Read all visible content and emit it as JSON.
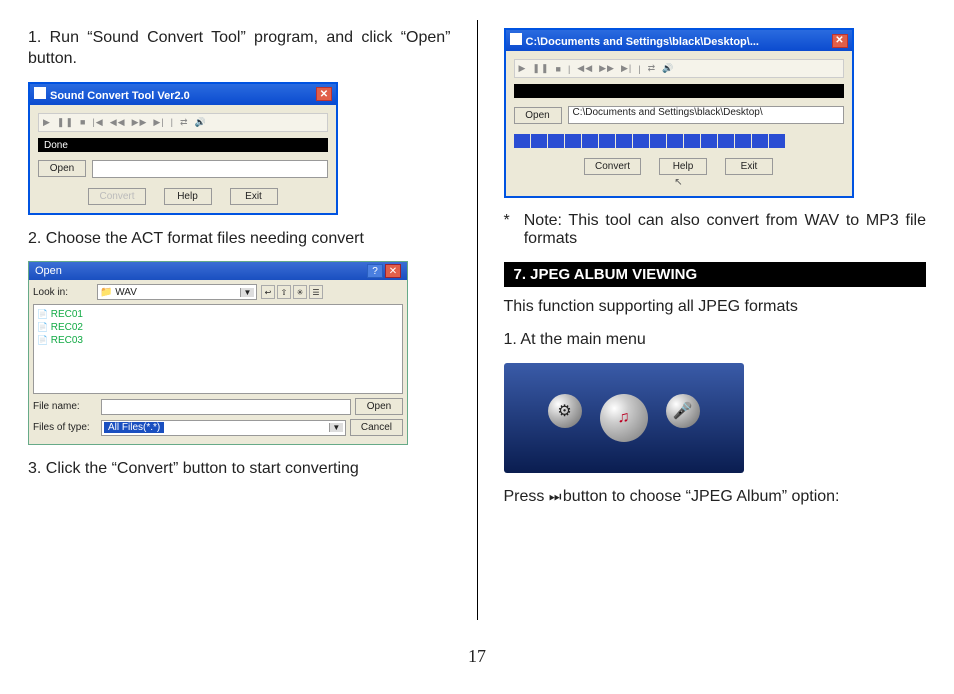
{
  "page_number": "17",
  "left": {
    "step1": "1. Run “Sound Convert Tool”  program, and click “Open”  button.",
    "win1": {
      "title": "Sound Convert Tool Ver2.0",
      "status": "Done",
      "open_btn": "Open",
      "convert_btn": "Convert",
      "help_btn": "Help",
      "exit_btn": "Exit"
    },
    "step2": "2. Choose the ACT format files needing convert",
    "open_dialog": {
      "title": "Open",
      "lookin_label": "Look in:",
      "lookin_value": "WAV",
      "files": [
        "REC01",
        "REC02",
        "REC03"
      ],
      "filename_label": "File name:",
      "filename_value": "",
      "filetype_label": "Files of type:",
      "filetype_value": "All Files(*.*)",
      "open_btn": "Open",
      "cancel_btn": "Cancel"
    },
    "step3": "3. Click the “Convert”  button to start converting"
  },
  "right": {
    "win2": {
      "title": "C:\\Documents and Settings\\black\\Desktop\\...",
      "open_btn": "Open",
      "path_value": "C:\\Documents and Settings\\black\\Desktop\\",
      "convert_btn": "Convert",
      "help_btn": "Help",
      "exit_btn": "Exit"
    },
    "note_mark": "*",
    "note": "Note: This tool can also convert from WAV to MP3 file formats",
    "section_title": "7.  JPEG ALBUM VIEWING",
    "intro": "This function supporting all JPEG formats",
    "step1": "1.  At the main menu",
    "press_pre": "Press ",
    "press_icon": "⏭",
    "press_post": " button to choose “JPEG Album” option:"
  }
}
